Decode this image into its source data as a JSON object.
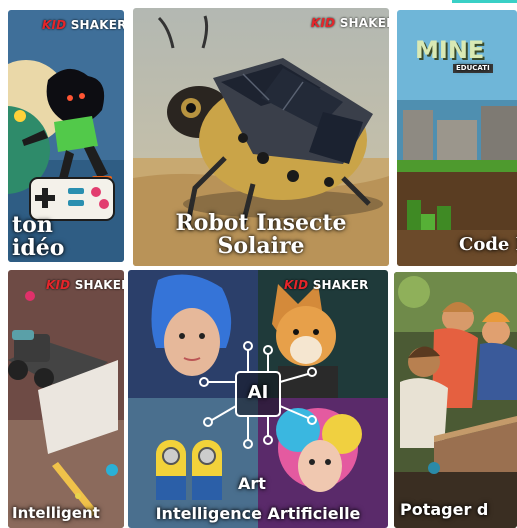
{
  "brand": {
    "kid": "KID",
    "shaker": "SHAKER"
  },
  "tiles": [
    {
      "title_line1": "ton",
      "title_line2": "idéo"
    },
    {
      "title_line1": "Robot Insecte",
      "title_line2": "Solaire"
    },
    {
      "logo_text": "MINE",
      "logo_sub": "EDUCATI",
      "title": "Code M"
    },
    {
      "title": "Intelligent"
    },
    {
      "ai_label": "AI",
      "art_label": "Art",
      "title": "Intelligence Artificielle"
    },
    {
      "title": "Potager d"
    }
  ],
  "colors": {
    "accent": "#39d0c6",
    "brand_red": "#e5252a"
  }
}
